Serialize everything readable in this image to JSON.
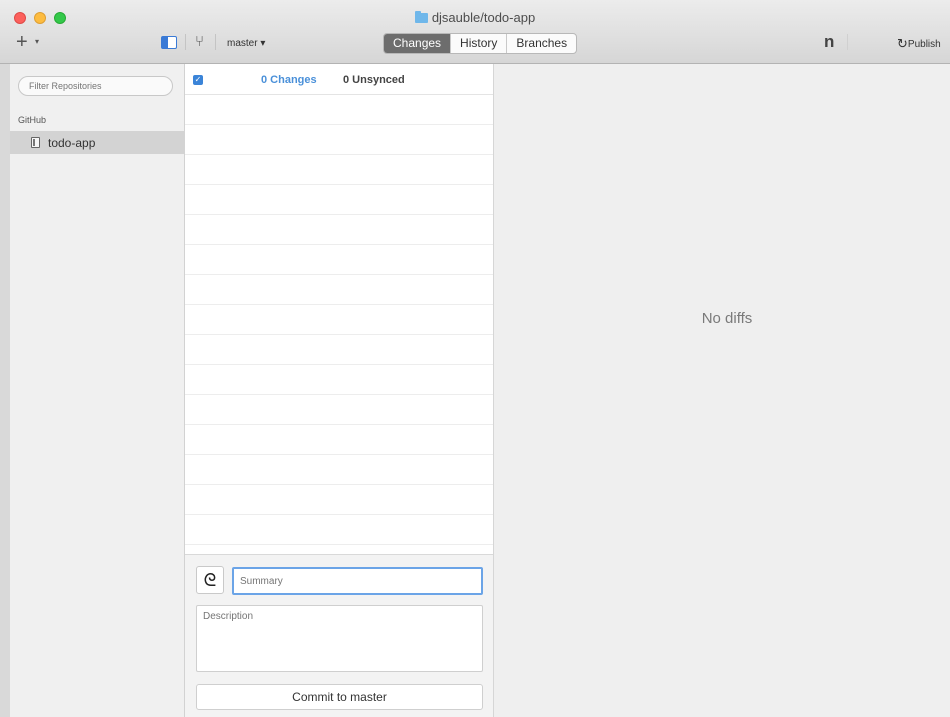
{
  "window": {
    "title": "djsauble/todo-app"
  },
  "toolbar": {
    "add_label": "+",
    "add_caret": "▾",
    "branch": "master ▾",
    "tabs": [
      {
        "label": "Changes",
        "active": true
      },
      {
        "label": "History",
        "active": false
      },
      {
        "label": "Branches",
        "active": false
      }
    ],
    "n_label": "n",
    "publish_label": "Publish",
    "icons": {
      "sidebar": "sidebar-toggle-icon",
      "branch": "branch-icon",
      "sync": "sync-icon"
    }
  },
  "sidebar": {
    "filter_placeholder": "Filter Repositories",
    "section": "GitHub",
    "repos": [
      {
        "label": "todo-app",
        "selected": true
      }
    ]
  },
  "changes": {
    "changes_label": "0 Changes",
    "unsynced_label": "0 Unsynced",
    "checked": true
  },
  "commit": {
    "summary_placeholder": "Summary",
    "description_placeholder": "Description",
    "button_label": "Commit to master"
  },
  "diff": {
    "empty_text": "No diffs"
  },
  "colors": {
    "accent": "#3b84d8",
    "active_tab": "#6d6d6d",
    "close": "#fc605c",
    "minimize": "#fdbc40",
    "maximize": "#34c84a"
  }
}
